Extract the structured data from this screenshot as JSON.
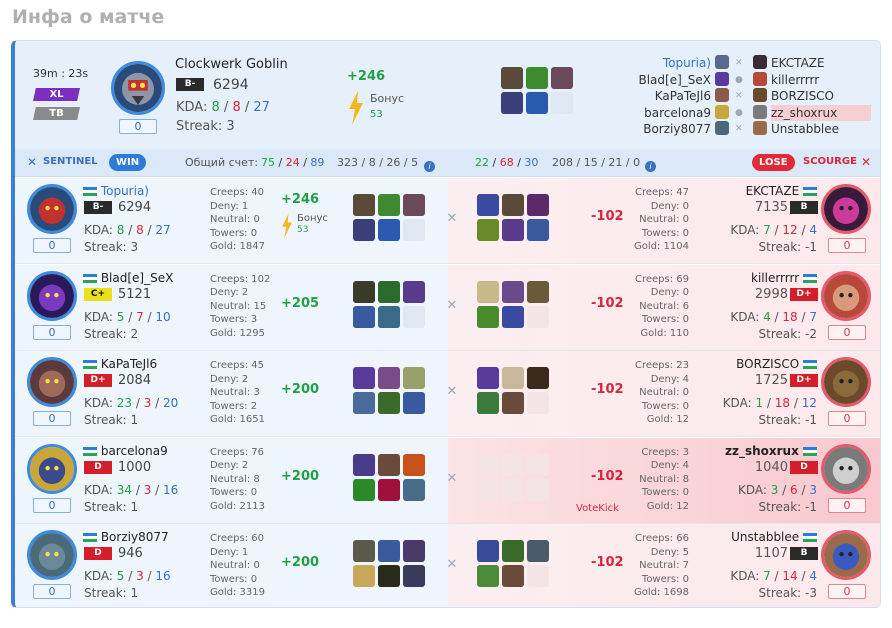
{
  "page_title": "Инфа о матче",
  "header": {
    "duration": "39m : 23s",
    "badge_xl": "XL",
    "badge_tb": "TB",
    "hero_name": "Clockwerk Goblin",
    "rank": "B-",
    "mmr": "6294",
    "kda_label": "KDA:",
    "kda_k": "8",
    "kda_d": "8",
    "kda_a": "27",
    "streak": "Streak: 3",
    "count": "0",
    "delta": "+246",
    "bonus_label": "Бонус",
    "bonus_value": "53"
  },
  "radiant_list": [
    "Topuria)",
    "Blad[e]_SeX",
    "KaPaTeJl6",
    "barcelona9",
    "Borziy8077"
  ],
  "dire_list": [
    "EKCTAZE",
    "killerrrrr",
    "BORZISCO",
    "zz_shoxrux",
    "Unstabblee"
  ],
  "score_bar": {
    "sentinel_label": "SENTINEL",
    "win_label": "WIN",
    "total_label": "Общий счет:",
    "left_k": "75",
    "left_d": "24",
    "left_a": "89",
    "left_extra": "323 / 8 / 26 / 5",
    "right_k": "22",
    "right_d": "68",
    "right_a": "30",
    "right_extra": "208 / 15 / 21 / 0",
    "lose_label": "LOSE",
    "scourge_label": "SCOURGE"
  },
  "rows": [
    {
      "l_name": "Topuria)",
      "l_rank": "B-",
      "l_mmr": "6294",
      "l_k": "8",
      "l_d": "8",
      "l_a": "27",
      "l_streak": "Streak: 3",
      "l_count": "0",
      "l_creeps": "Creeps: 40",
      "l_deny": "Deny: 1",
      "l_neutral": "Neutral: 0",
      "l_towers": "Towers: 0",
      "l_gold": "Gold: 1847",
      "l_delta": "+246",
      "l_bonus": "Бонус",
      "l_bonus_v": "53",
      "r_creeps": "Creeps: 47",
      "r_deny": "Deny: 0",
      "r_neutral": "Neutral: 0",
      "r_towers": "Towers: 0",
      "r_gold": "Gold: 1104",
      "r_delta": "-102",
      "r_name": "EKCTAZE",
      "r_rank": "B",
      "r_mmr": "7135",
      "r_k": "7",
      "r_d": "12",
      "r_a": "4",
      "r_streak": "Streak: -1",
      "r_count": "0"
    },
    {
      "l_name": "Blad[e]_SeX",
      "l_rank": "C+",
      "l_mmr": "5121",
      "l_k": "5",
      "l_d": "7",
      "l_a": "10",
      "l_streak": "Streak: 2",
      "l_count": "0",
      "l_creeps": "Creeps: 102",
      "l_deny": "Deny: 2",
      "l_neutral": "Neutral: 15",
      "l_towers": "Towers: 3",
      "l_gold": "Gold: 1295",
      "l_delta": "+205",
      "r_creeps": "Creeps: 69",
      "r_deny": "Deny: 0",
      "r_neutral": "Neutral: 6",
      "r_towers": "Towers: 0",
      "r_gold": "Gold: 110",
      "r_delta": "-102",
      "r_name": "killerrrrr",
      "r_rank": "D+",
      "r_mmr": "2998",
      "r_k": "4",
      "r_d": "18",
      "r_a": "7",
      "r_streak": "Streak: -2",
      "r_count": "0"
    },
    {
      "l_name": "KaPaTeJl6",
      "l_rank": "D+",
      "l_mmr": "2084",
      "l_k": "23",
      "l_d": "3",
      "l_a": "20",
      "l_streak": "Streak: 1",
      "l_count": "0",
      "l_creeps": "Creeps: 45",
      "l_deny": "Deny: 2",
      "l_neutral": "Neutral: 3",
      "l_towers": "Towers: 2",
      "l_gold": "Gold: 1651",
      "l_delta": "+200",
      "r_creeps": "Creeps: 23",
      "r_deny": "Deny: 4",
      "r_neutral": "Neutral: 0",
      "r_towers": "Towers: 0",
      "r_gold": "Gold: 12",
      "r_delta": "-102",
      "r_name": "BORZISCO",
      "r_rank": "D+",
      "r_mmr": "1725",
      "r_k": "1",
      "r_d": "18",
      "r_a": "12",
      "r_streak": "Streak: -1",
      "r_count": "0"
    },
    {
      "l_name": "barcelona9",
      "l_rank": "D",
      "l_mmr": "1000",
      "l_k": "34",
      "l_d": "3",
      "l_a": "16",
      "l_streak": "Streak: 1",
      "l_count": "0",
      "l_creeps": "Creeps: 76",
      "l_deny": "Deny: 2",
      "l_neutral": "Neutral: 8",
      "l_towers": "Towers: 0",
      "l_gold": "Gold: 2113",
      "l_delta": "+200",
      "r_creeps": "Creeps: 3",
      "r_deny": "Deny: 4",
      "r_neutral": "Neutral: 8",
      "r_towers": "Towers: 0",
      "r_gold": "Gold: 12",
      "r_delta": "-102",
      "r_votekick": "VoteKick",
      "r_name": "zz_shoxrux",
      "r_rank": "D",
      "r_mmr": "1040",
      "r_k": "3",
      "r_d": "6",
      "r_a": "3",
      "r_streak": "Streak: -1",
      "r_count": "0"
    },
    {
      "l_name": "Borziy8077",
      "l_rank": "D",
      "l_mmr": "946",
      "l_k": "5",
      "l_d": "3",
      "l_a": "16",
      "l_streak": "Streak: 1",
      "l_count": "0",
      "l_creeps": "Creeps: 60",
      "l_deny": "Deny: 1",
      "l_neutral": "Neutral: 0",
      "l_towers": "Towers: 0",
      "l_gold": "Gold: 3319",
      "l_delta": "+200",
      "r_creeps": "Creeps: 66",
      "r_deny": "Deny: 5",
      "r_neutral": "Neutral: 7",
      "r_towers": "Towers: 0",
      "r_gold": "Gold: 1698",
      "r_delta": "-102",
      "r_name": "Unstabblee",
      "r_rank": "B",
      "r_mmr": "1107",
      "r_k": "7",
      "r_d": "14",
      "r_a": "4",
      "r_streak": "Streak: -3",
      "r_count": "0"
    }
  ],
  "colors": {
    "accent": "#3b82d6",
    "win": "#2d7bd6",
    "lose": "#e12a36",
    "positive": "#21a047",
    "negative": "#d7263a"
  }
}
